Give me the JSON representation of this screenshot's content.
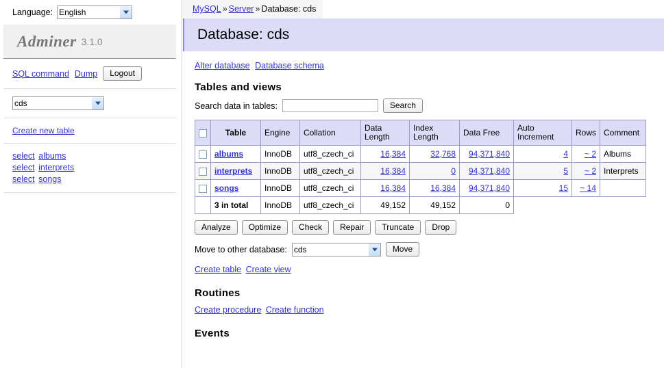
{
  "sidebar": {
    "language_label": "Language:",
    "language_value": "English",
    "language_options": [
      "English"
    ],
    "logo_name": "Adminer",
    "logo_version": "3.1.0",
    "sql_command_label": "SQL command",
    "dump_label": "Dump",
    "logout_label": "Logout",
    "database_value": "cds",
    "database_options": [
      "cds"
    ],
    "create_new_table_label": "Create new table",
    "tables": [
      {
        "select_label": "select",
        "name": "albums"
      },
      {
        "select_label": "select",
        "name": "interprets"
      },
      {
        "select_label": "select",
        "name": "songs"
      }
    ]
  },
  "main": {
    "breadcrumb": {
      "server_type": "MySQL",
      "sep1": "»",
      "server": "Server",
      "sep2": "»",
      "current": "Database: cds"
    },
    "page_title": "Database: cds",
    "alter_database_label": "Alter database",
    "database_schema_label": "Database schema",
    "tables_heading": "Tables and views",
    "search": {
      "label": "Search data in tables:",
      "value": "",
      "placeholder": "",
      "button_label": "Search"
    },
    "table": {
      "headers": {
        "checkbox": "",
        "table": "Table",
        "engine": "Engine",
        "collation": "Collation",
        "data_length": "Data Length",
        "index_length": "Index Length",
        "data_free": "Data Free",
        "auto_increment": "Auto Increment",
        "rows": "Rows",
        "comment": "Comment"
      },
      "rows": [
        {
          "name": "albums",
          "engine": "InnoDB",
          "collation": "utf8_czech_ci",
          "data_length": "16,384",
          "index_length": "32,768",
          "data_free": "94,371,840",
          "auto_increment": "4",
          "rows": "~ 2",
          "comment": "Albums"
        },
        {
          "name": "interprets",
          "engine": "InnoDB",
          "collation": "utf8_czech_ci",
          "data_length": "16,384",
          "index_length": "0",
          "data_free": "94,371,840",
          "auto_increment": "5",
          "rows": "~ 2",
          "comment": "Interprets"
        },
        {
          "name": "songs",
          "engine": "InnoDB",
          "collation": "utf8_czech_ci",
          "data_length": "16,384",
          "index_length": "16,384",
          "data_free": "94,371,840",
          "auto_increment": "15",
          "rows": "~ 14",
          "comment": ""
        }
      ],
      "total": {
        "label": "3 in total",
        "engine": "InnoDB",
        "collation": "utf8_czech_ci",
        "data_length": "49,152",
        "index_length": "49,152",
        "data_free": "0"
      }
    },
    "actions": {
      "analyze": "Analyze",
      "optimize": "Optimize",
      "check": "Check",
      "repair": "Repair",
      "truncate": "Truncate",
      "drop": "Drop"
    },
    "move": {
      "label": "Move to other database:",
      "value": "cds",
      "options": [
        "cds"
      ],
      "button_label": "Move"
    },
    "create_table_label": "Create table",
    "create_view_label": "Create view",
    "routines_heading": "Routines",
    "create_procedure_label": "Create procedure",
    "create_function_label": "Create function",
    "events_heading": "Events"
  },
  "colors": {
    "accent": "#dcdcf8",
    "link": "#3333cc",
    "table_border": "#9999cc",
    "odd_row": "#f6f6f6"
  }
}
